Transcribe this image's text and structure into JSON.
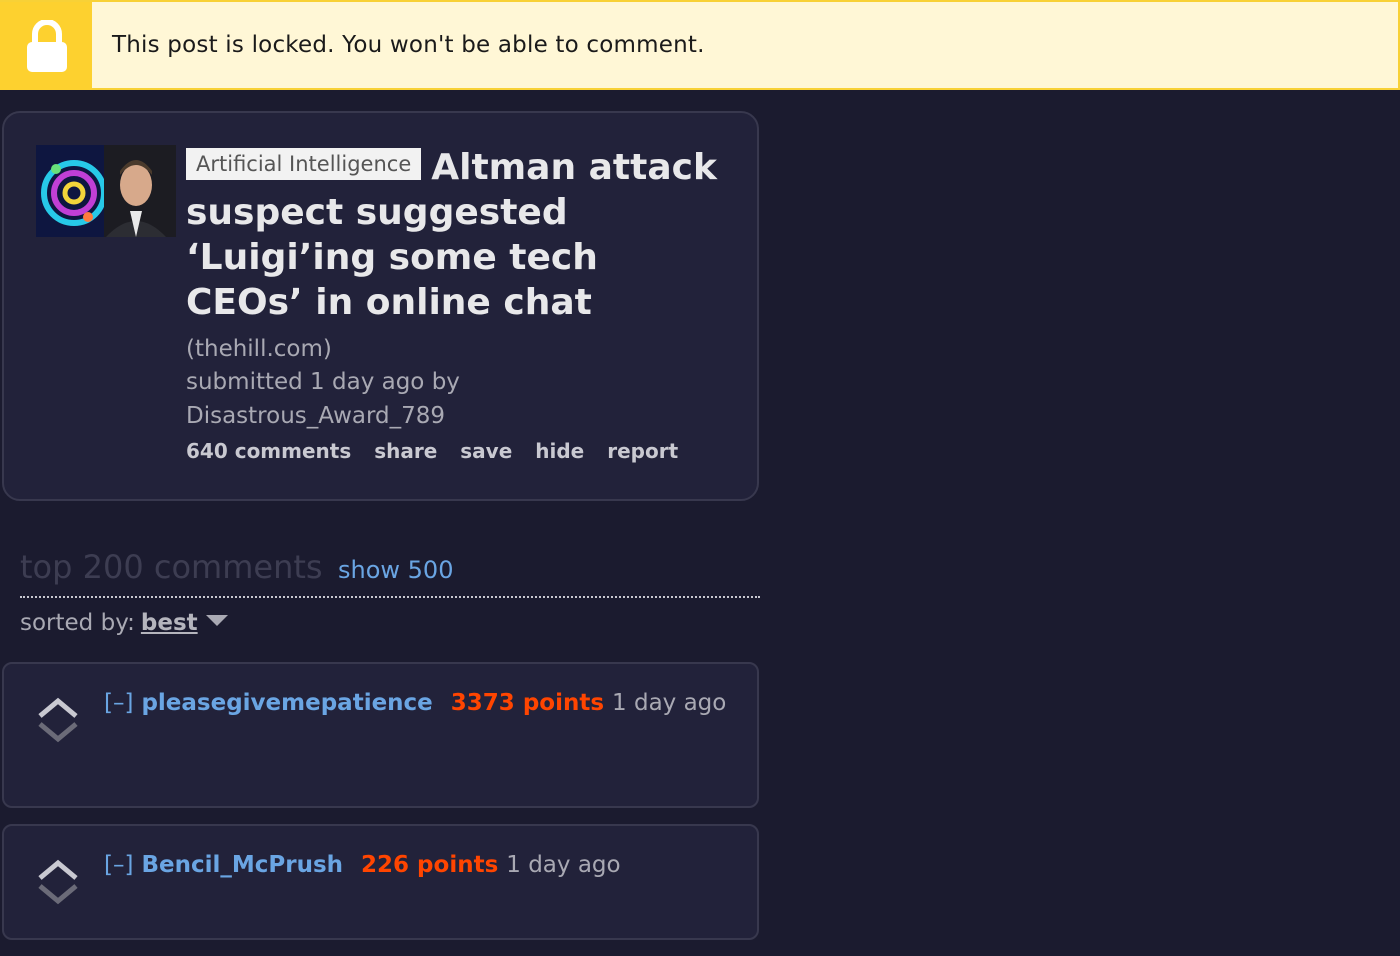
{
  "banner": {
    "text": "This post is locked. You won't be able to comment.",
    "icon": "lock-icon"
  },
  "post": {
    "flair": "Artificial Intelligence",
    "title": "Altman attack suspect suggested ‘Luigi’ing some tech CEOs’ in online chat",
    "domain": "(thehill.com)",
    "tagline_1": "submitted 1 day ago by",
    "author": "Disastrous_Award_789",
    "buttons": {
      "comments": "640 comments",
      "share": "share",
      "save": "save",
      "hide": "hide",
      "report": "report"
    }
  },
  "comments_header": {
    "title": "top 200 comments",
    "show_more": "show 500",
    "sorted_label": "sorted by:",
    "sorted_value": "best"
  },
  "comments": [
    {
      "collapse": "[–]",
      "author": "pleasegivemepatience",
      "score": "3373 points",
      "time": "1 day ago"
    },
    {
      "collapse": "[–]",
      "author": "Bencil_McPrush",
      "score": "226 points",
      "time": "1 day ago"
    }
  ],
  "colors": {
    "background": "#1b1b2f",
    "banner_bg": "#fff7d6",
    "lock_bg": "#fdd12f",
    "link": "#6aa5e3",
    "score": "#ff4500"
  }
}
